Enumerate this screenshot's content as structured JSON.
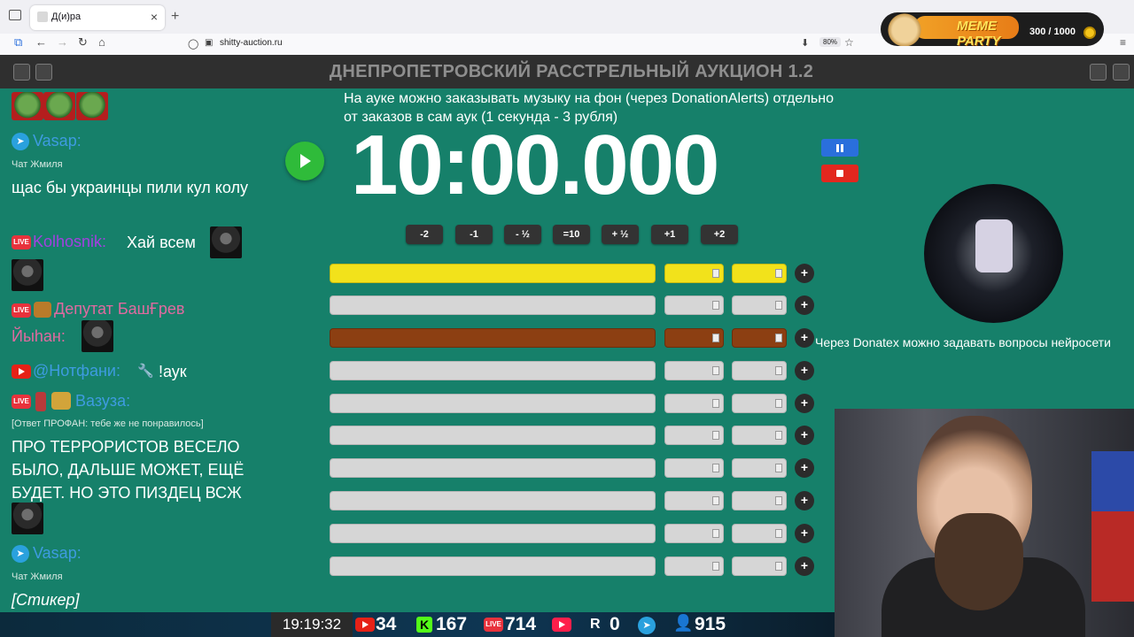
{
  "browser": {
    "tab_title": "Д(и)ра",
    "url": "shitty-auction.ru",
    "zoom": "80%"
  },
  "meme_party": {
    "title": "MEME PARTY",
    "count": "300 / 1000"
  },
  "app": {
    "title": "ДНЕПРОПЕТРОВСКИЙ РАССТРЕЛЬНЫЙ АУКЦИОН 1.2"
  },
  "chat": {
    "m1_name": "Vasap:",
    "m1_sub": "Чат Жмиля",
    "m1_text": "щас бы украинцы пили кул колу",
    "m2_name": "Kolhosnik:",
    "m2_text": "Хай всем",
    "m3_name": "Депутат БашҒрев",
    "m3_name2": "Йыhан:",
    "m4_name": "@Нотфани:",
    "m4_text": "!аук",
    "m5_name": "Вазуза:",
    "m5_reply": "[Ответ ПРОФАН: тебе же не понравилось]",
    "m5_text": "ПРО ТЕРРОРИСТОВ ВЕСЕЛО БЫЛО, ДАЛЬШЕ МОЖЕТ, ЕЩЁ БУДЕТ. НО ЭТО ПИЗДЕЦ ВСЖ",
    "m6_name": "Vasap:",
    "m6_sub": "Чат Жмиля",
    "m6_text": "[Стикер]"
  },
  "auction": {
    "note": "На ауке можно заказывать музыку на фон (через DonationAlerts) отдельно от заказов в сам аук (1 секунда - 3 рубля)",
    "timer": "10:00.000",
    "adjust": [
      "-2",
      "-1",
      "- ½",
      "=10",
      "+ ½",
      "+1",
      "+2"
    ],
    "add_label": "+"
  },
  "right": {
    "donatex": "Через Donatex можно задавать вопросы нейросети"
  },
  "stats": {
    "clock": "19:19:32",
    "youtube": "34",
    "kick": "167",
    "live": "714",
    "vk": "0",
    "rutube": "",
    "telegram": "",
    "viewers": "915"
  },
  "colors": {
    "panel": "#16806a",
    "lot1": "#f2e21b",
    "lot3": "#8c3f12",
    "play": "#2fbb3a",
    "pause": "#2a6fdc",
    "stop": "#e2271e"
  }
}
